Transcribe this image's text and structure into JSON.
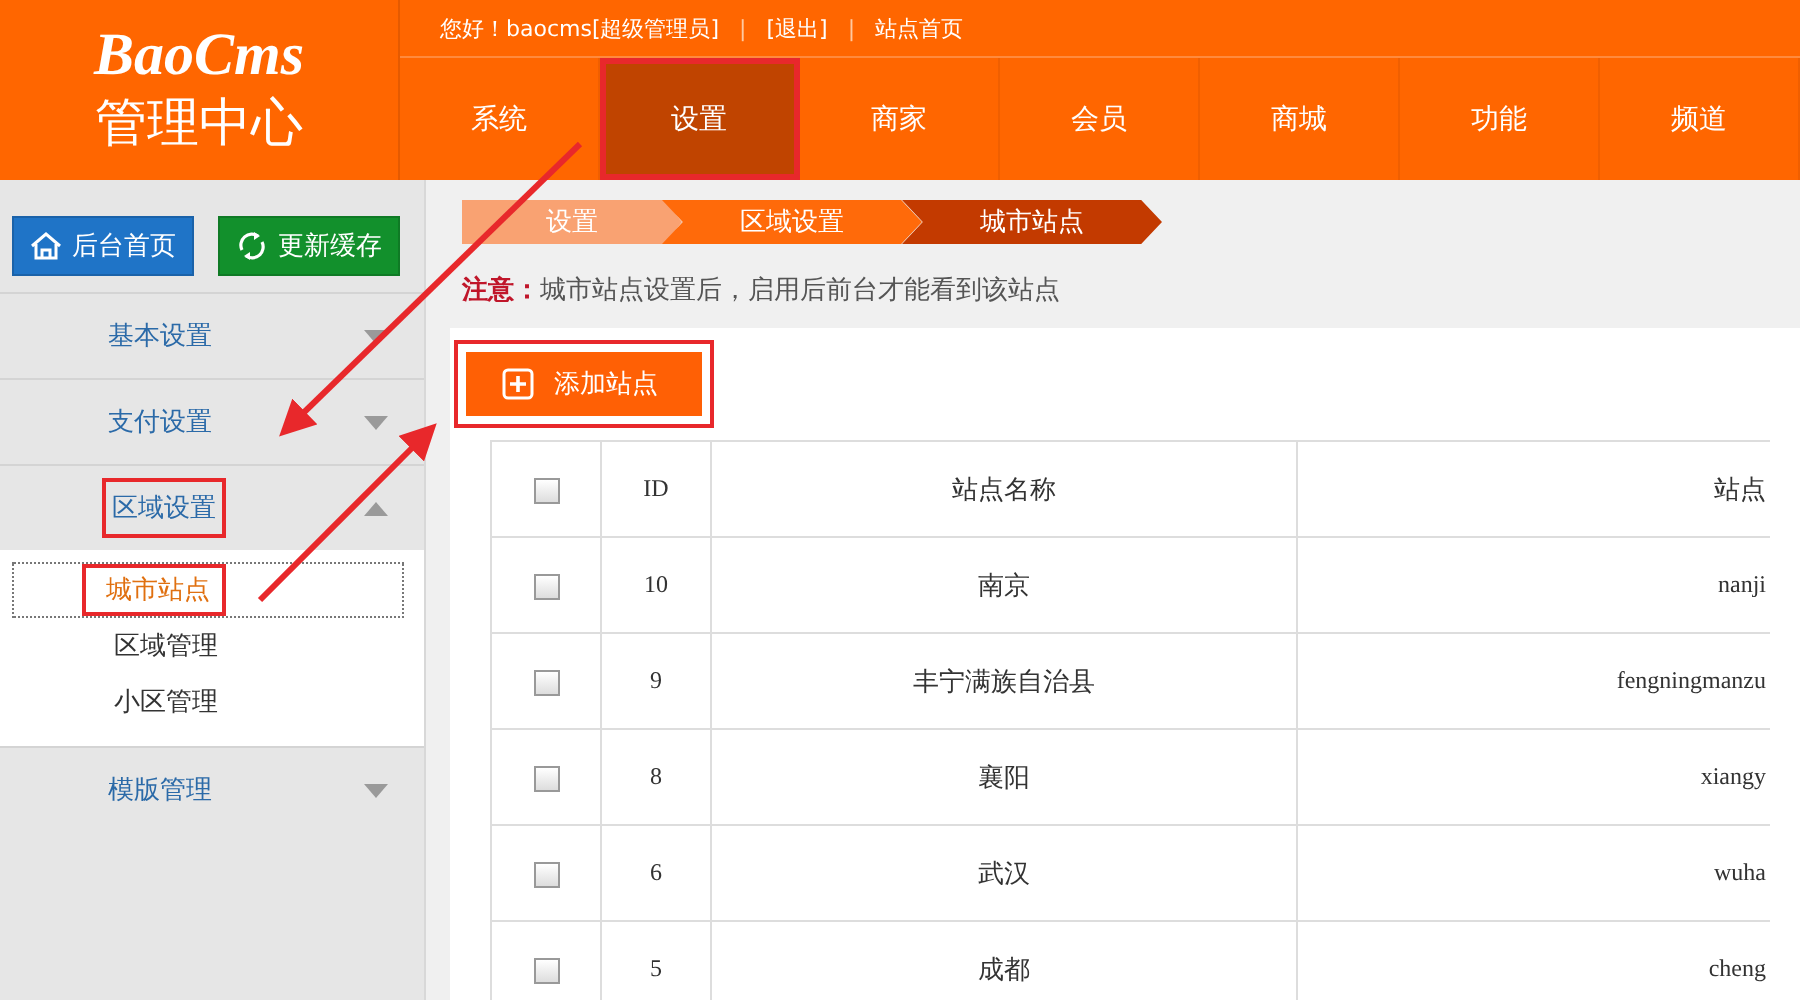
{
  "header": {
    "logo": "BaoCms",
    "title": "管理中心",
    "greeting": "您好！baocms[超级管理员]",
    "separator": "|",
    "links": [
      "[退出]",
      "站点首页"
    ],
    "nav": [
      {
        "label": "系统",
        "selected": false,
        "highlighted": false
      },
      {
        "label": "设置",
        "selected": true,
        "highlighted": true
      },
      {
        "label": "商家",
        "selected": false,
        "highlighted": false
      },
      {
        "label": "会员",
        "selected": false,
        "highlighted": false
      },
      {
        "label": "商城",
        "selected": false,
        "highlighted": false
      },
      {
        "label": "功能",
        "selected": false,
        "highlighted": false
      },
      {
        "label": "频道",
        "selected": false,
        "highlighted": false
      }
    ]
  },
  "sidebar": {
    "buttons": [
      {
        "label": "后台首页",
        "kind": "home"
      },
      {
        "label": "更新缓存",
        "kind": "refresh"
      }
    ],
    "items": [
      {
        "label": "基本设置",
        "expanded": false,
        "highlighted": false
      },
      {
        "label": "支付设置",
        "expanded": false,
        "highlighted": false
      },
      {
        "label": "区域设置",
        "expanded": true,
        "highlighted": true,
        "children": [
          {
            "label": "城市站点",
            "selected": true,
            "highlighted": true
          },
          {
            "label": "区域管理",
            "selected": false,
            "highlighted": false
          },
          {
            "label": "小区管理",
            "selected": false,
            "highlighted": false
          }
        ]
      },
      {
        "label": "模版管理",
        "expanded": false,
        "highlighted": false
      }
    ]
  },
  "breadcrumb": [
    {
      "label": "设置",
      "selected": false
    },
    {
      "label": "区域设置",
      "selected": false
    },
    {
      "label": "城市站点",
      "selected": true
    }
  ],
  "notice": {
    "label": "注意：",
    "text": "城市站点设置后，启用后前台才能看到该站点"
  },
  "add_button": {
    "label": "添加站点",
    "highlighted": true
  },
  "table": {
    "all_checked": false,
    "columns": [
      "ID",
      "站点名称",
      "站点"
    ],
    "rows": [
      {
        "checked": false,
        "cells": [
          "10",
          "南京",
          "nanji"
        ]
      },
      {
        "checked": false,
        "cells": [
          "9",
          "丰宁满族自治县",
          "fengningmanzu"
        ]
      },
      {
        "checked": false,
        "cells": [
          "8",
          "襄阳",
          "xiangy"
        ]
      },
      {
        "checked": false,
        "cells": [
          "6",
          "武汉",
          "wuha"
        ]
      },
      {
        "checked": false,
        "cells": [
          "5",
          "成都",
          "cheng"
        ]
      }
    ]
  }
}
